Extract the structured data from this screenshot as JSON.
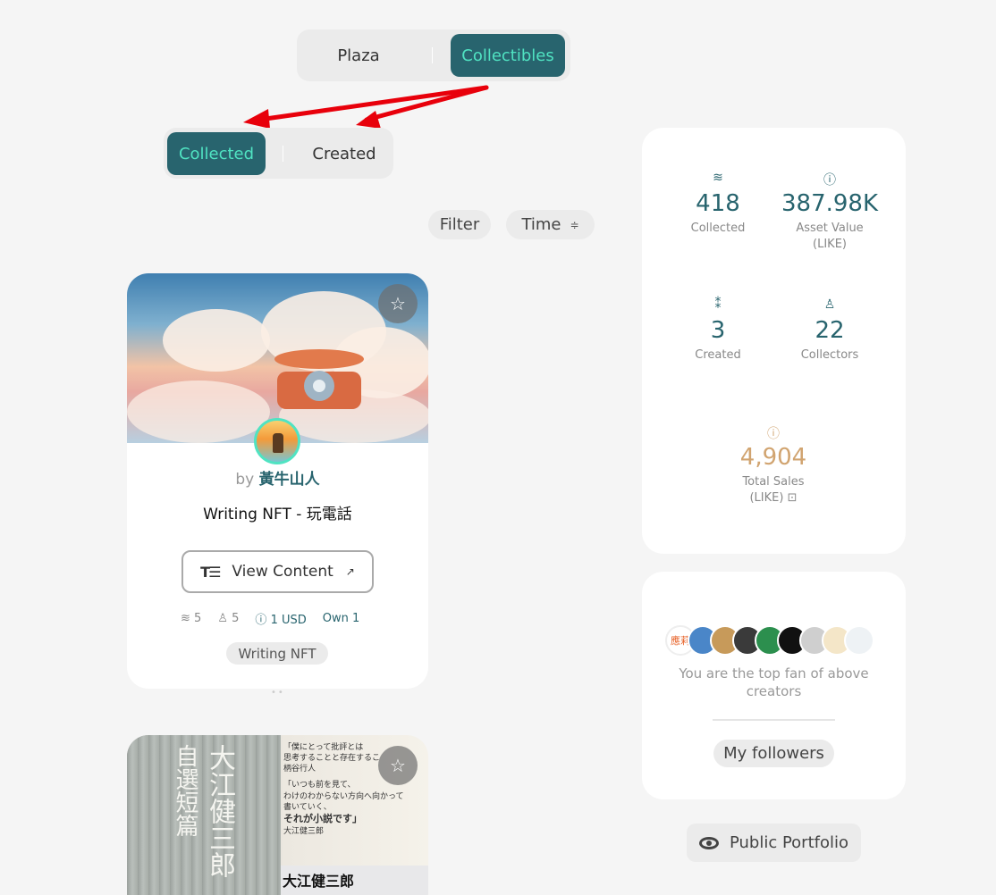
{
  "tabs": {
    "plaza": "Plaza",
    "collectibles": "Collectibles"
  },
  "subtabs": {
    "collected": "Collected",
    "created": "Created"
  },
  "toolbar": {
    "filter": "Filter",
    "time": "Time",
    "sort_icon": "sort-icon"
  },
  "card": {
    "by_prefix": "by",
    "author": "黃牛山人",
    "title": "Writing NFT - 玩電話",
    "view_content": "View Content",
    "collected_count": "5",
    "collectors_count": "5",
    "price": "1 USD",
    "own": "Own 1",
    "tag": "Writing NFT"
  },
  "card2": {
    "cover_title_1": "大江健三郎",
    "cover_title_2": "自選短篇",
    "quote_1": "「僕にとって批評とは",
    "quote_2": "思考することと存在するこ",
    "quote_3": "柄谷行人",
    "quote_4": "「いつも前を見て、",
    "quote_5": "わけのわからない方向へ向かって",
    "quote_6": "書いていく、",
    "quote_7": "それが小説です」",
    "quote_8": "大江健三郎",
    "author": "大江健三郎"
  },
  "stats": {
    "collected": {
      "value": "418",
      "label": "Collected"
    },
    "asset_value": {
      "value": "387.98K",
      "label": "Asset Value",
      "unit": "(LIKE)"
    },
    "created": {
      "value": "3",
      "label": "Created"
    },
    "collectors": {
      "value": "22",
      "label": "Collectors"
    },
    "total_sales": {
      "value": "4,904",
      "label": "Total Sales",
      "unit": "(LIKE)"
    }
  },
  "fans": {
    "text": "You are the top fan of above creators",
    "button": "My followers",
    "avatar_label_1": "應莉"
  },
  "public_portfolio": "Public Portfolio",
  "colors": {
    "primary": "#28646e",
    "accent": "#50e3c2",
    "sales": "#d1a470",
    "annotation": "#e8000b"
  }
}
